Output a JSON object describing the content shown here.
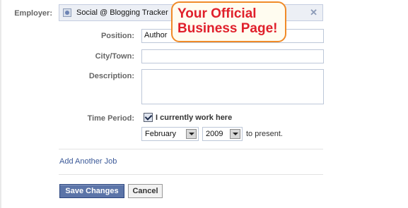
{
  "form": {
    "employer": {
      "label": "Employer:",
      "value": "Social @ Blogging Tracker",
      "remove_glyph": "✕",
      "icon": "page-icon"
    },
    "position": {
      "label": "Position:",
      "value": "Author"
    },
    "city": {
      "label": "City/Town:",
      "value": ""
    },
    "description": {
      "label": "Description:",
      "value": ""
    },
    "time_period": {
      "label": "Time Period:",
      "currently_work_label": "I currently work here",
      "currently_work_checked": true,
      "month": "February",
      "year": "2009",
      "to_present": "to present."
    },
    "add_job_link": "Add Another Job",
    "save_label": "Save Changes",
    "cancel_label": "Cancel"
  },
  "callout": {
    "line1": "Your Official",
    "line2": "Business Page!",
    "border_color": "#f08a28",
    "text_color": "#e0202b"
  },
  "colors": {
    "link": "#3b5998",
    "primary_button": "#5b74a8",
    "label": "#666666"
  }
}
